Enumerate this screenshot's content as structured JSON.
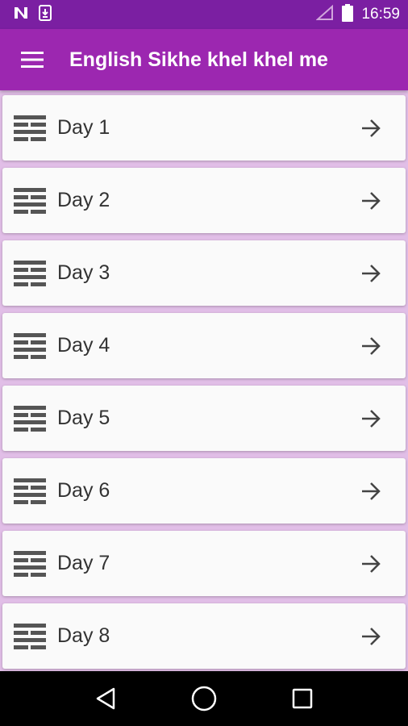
{
  "status_bar": {
    "time": "16:59",
    "left_icons": [
      "n-icon",
      "download-icon"
    ],
    "right_icons": [
      "signal-icon",
      "battery-icon"
    ]
  },
  "app_bar": {
    "title": "English Sikhe khel khel me",
    "menu_icon": "hamburger-menu-icon"
  },
  "list": {
    "items": [
      {
        "label": "Day 1"
      },
      {
        "label": "Day 2"
      },
      {
        "label": "Day 3"
      },
      {
        "label": "Day 4"
      },
      {
        "label": "Day 5"
      },
      {
        "label": "Day 6"
      },
      {
        "label": "Day 7"
      },
      {
        "label": "Day 8"
      }
    ],
    "item_icon": "list-lines-icon",
    "arrow_icon": "arrow-right-icon"
  },
  "nav_bar": {
    "buttons": [
      "back-icon",
      "home-icon",
      "recents-icon"
    ]
  },
  "colors": {
    "status_bar": "#7b1fa2",
    "app_bar": "#9c27b0",
    "background": "#e1bee7",
    "card": "#fafafa"
  }
}
